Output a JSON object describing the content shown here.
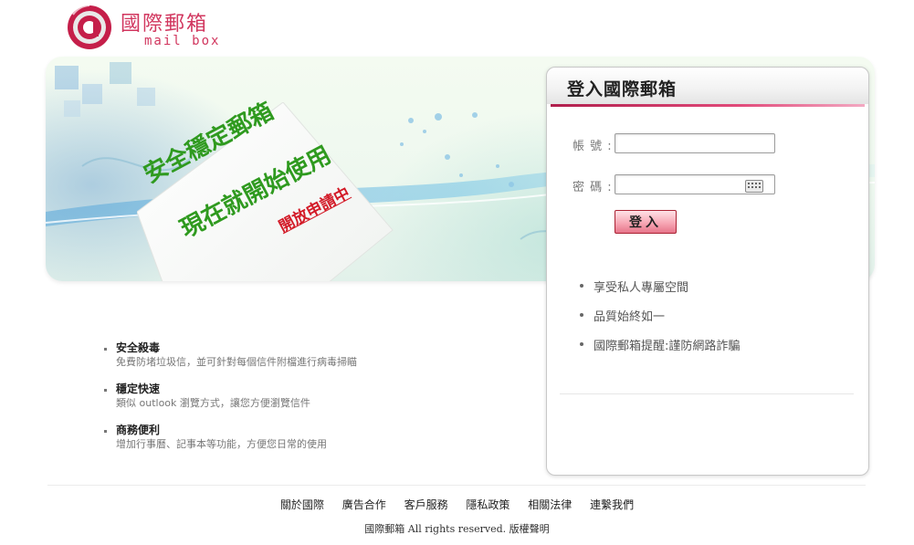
{
  "logo": {
    "title": "國際郵箱",
    "subtitle": "mail box"
  },
  "banner": {
    "headline_line1": "安全穩定郵箱",
    "headline_line2": "現在就開始使用",
    "apply_link": "開放申請中"
  },
  "login": {
    "title": "登入國際郵箱",
    "account_label": "帳 號 :",
    "account_value": "",
    "password_label": "密 碼 :",
    "password_value": "",
    "button": "登入",
    "info": [
      "享受私人專屬空間",
      "品質始終如一",
      "國際郵箱提醒:謹防網路詐騙"
    ]
  },
  "features": [
    {
      "title": "安全殺毒",
      "desc": "免費防堵垃圾信，並可針對每個信件附檔進行病毒掃瞄"
    },
    {
      "title": "穩定快速",
      "desc": "類似 outlook 瀏覽方式，讓您方便瀏覽信件"
    },
    {
      "title": "商務便利",
      "desc": "增加行事曆、記事本等功能，方便您日常的使用"
    }
  ],
  "footer": {
    "links": [
      "關於國際",
      "廣告合作",
      "客戶服務",
      "隱私政策",
      "相關法律",
      "連繫我們"
    ],
    "copyright": "國際郵箱 All rights reserved. 版權聲明"
  },
  "colors": {
    "brand": "#d1365e",
    "headline": "#2f9a1f",
    "apply": "#d31b28"
  }
}
